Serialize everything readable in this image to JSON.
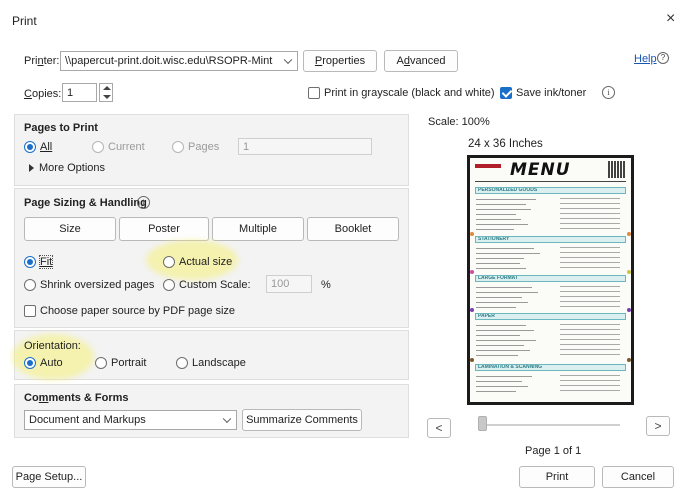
{
  "window": {
    "title": "Print",
    "close_glyph": "×"
  },
  "top": {
    "printer_label": "Printer:",
    "printer_value": "\\\\papercut-print.doit.wisc.edu\\RSOPR-Mint",
    "properties_label": "Properties",
    "advanced_label": "Advanced",
    "help_label": "Help",
    "copies_label": "Copies:",
    "copies_value": "1",
    "grayscale_label": "Print in grayscale (black and white)",
    "grayscale_checked": false,
    "save_ink_label": "Save ink/toner",
    "save_ink_checked": true
  },
  "pages_to_print": {
    "title": "Pages to Print",
    "all_label": "All",
    "current_label": "Current",
    "pages_label": "Pages",
    "pages_value": "1",
    "more_options_label": "More Options",
    "selected": "all"
  },
  "sizing": {
    "title": "Page Sizing & Handling",
    "tabs": [
      "Size",
      "Poster",
      "Multiple",
      "Booklet"
    ],
    "fit_label": "Fit",
    "actual_size_label": "Actual size",
    "shrink_label": "Shrink oversized pages",
    "custom_scale_label": "Custom Scale:",
    "custom_scale_value": "100",
    "percent_label": "%",
    "paper_source_label": "Choose paper source by PDF page size",
    "selected": "fit"
  },
  "orientation": {
    "title": "Orientation:",
    "auto_label": "Auto",
    "portrait_label": "Portrait",
    "landscape_label": "Landscape",
    "selected": "auto"
  },
  "comments": {
    "title": "Comments & Forms",
    "select_value": "Document and Markups",
    "summarize_label": "Summarize Comments"
  },
  "preview": {
    "scale_label": "Scale: 100%",
    "size_label": "24 x 36 Inches",
    "menu_title": "MENU",
    "sections": [
      "PERSONALIZED GOODS",
      "STATIONERY",
      "LARGE FORMAT",
      "PAPER",
      "LAMINATION & SCANNING"
    ],
    "prev_glyph": "<",
    "next_glyph": ">",
    "page_status": "Page 1 of 1"
  },
  "footer": {
    "page_setup_label": "Page Setup...",
    "print_label": "Print",
    "cancel_label": "Cancel"
  },
  "colors": {
    "accent": "#1a6fc9",
    "highlight": "#f5f078",
    "menu_teal": "#6bb7be"
  }
}
